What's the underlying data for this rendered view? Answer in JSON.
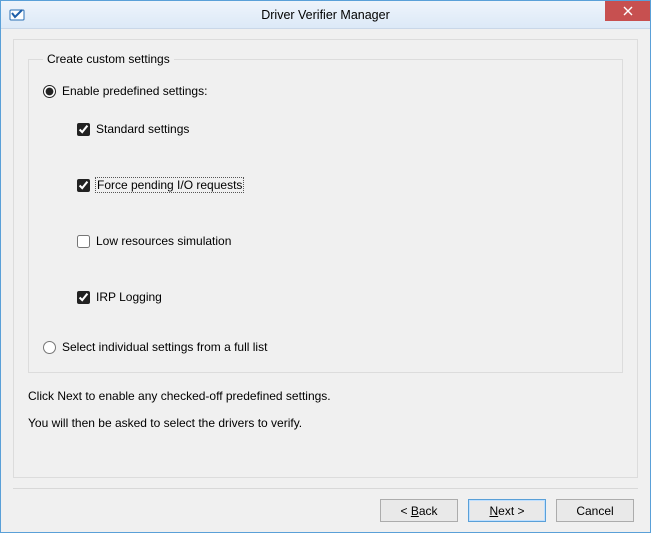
{
  "window": {
    "title": "Driver Verifier Manager"
  },
  "group": {
    "legend": "Create custom settings"
  },
  "radio": {
    "enable_predefined": "Enable predefined settings:",
    "select_from_list": "Select individual settings from a full list"
  },
  "checks": {
    "standard": "Standard settings",
    "force_pending": "Force pending I/O requests",
    "low_resources": "Low resources simulation",
    "irp_logging": "IRP Logging"
  },
  "instructions": {
    "line1": "Click Next to enable any checked-off predefined settings.",
    "line2": "You will then be asked to select the drivers to verify."
  },
  "buttons": {
    "back_pre": "< ",
    "back_mn": "B",
    "back_post": "ack",
    "next_mn": "N",
    "next_post": "ext >",
    "cancel": "Cancel"
  }
}
